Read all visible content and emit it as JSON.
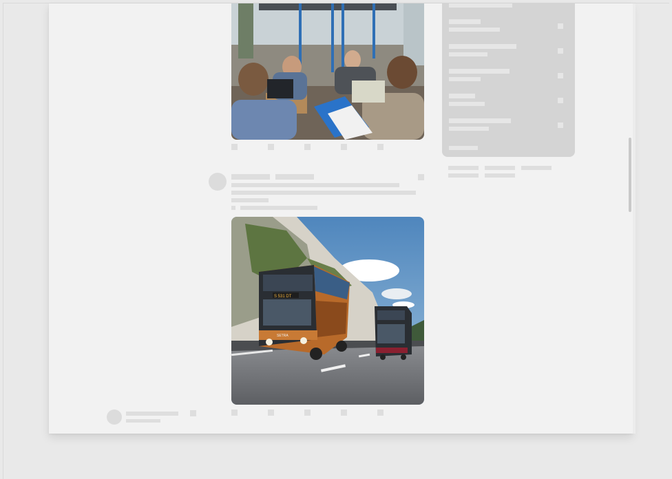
{
  "photos": [
    {
      "id": "bus-interior-meeting",
      "alt": ""
    },
    {
      "id": "double-decker-coach-road",
      "alt": ""
    }
  ],
  "bus_destination_sign": "S 531 DT",
  "bus_brand": "SETRA",
  "colors": {
    "background": "#e9e9e9",
    "page": "#f2f2f2",
    "skeleton": "#dedede",
    "sidebar_card": "#d4d4d4"
  }
}
